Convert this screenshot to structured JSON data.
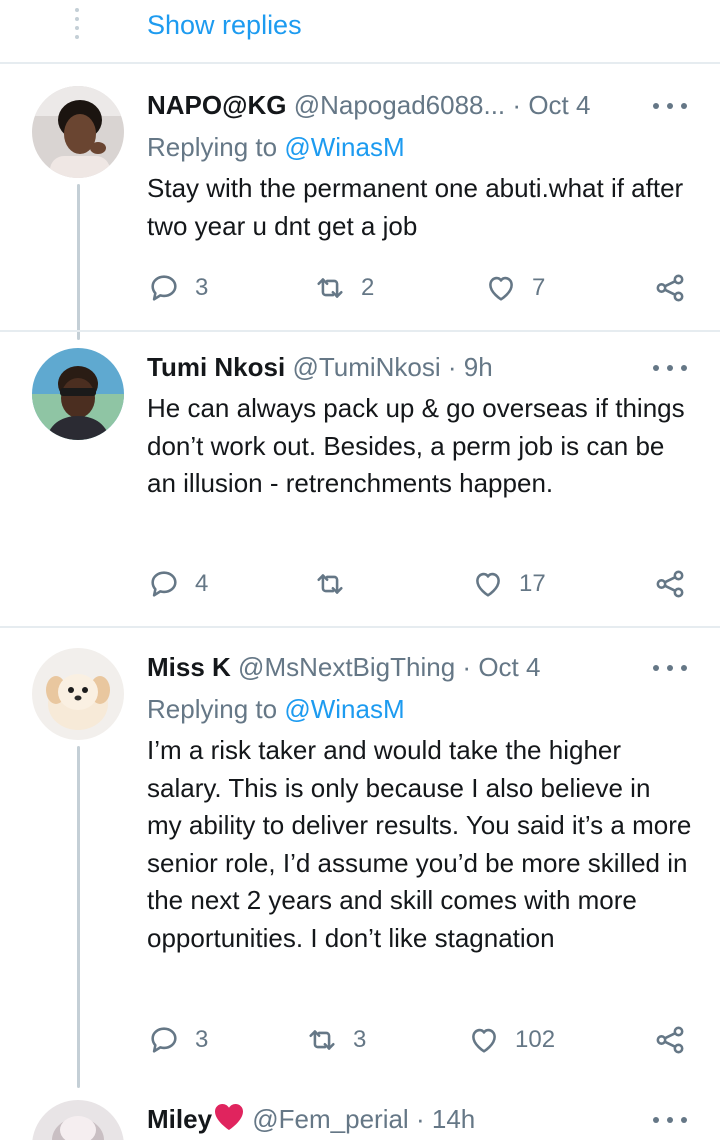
{
  "show_replies": "Show replies",
  "tweets": [
    {
      "name": "NAPO@KG",
      "handle": "@Napogad6088...",
      "time": "Oct 4",
      "replying_prefix": "Replying to",
      "replying_to": "@WinasM",
      "text": "Stay with the permanent one abuti.what if after two year u dnt get a job",
      "replies": "3",
      "retweets": "2",
      "likes": "7"
    },
    {
      "name": "Tumi Nkosi",
      "handle": "@TumiNkosi",
      "time": "9h",
      "text": "He can always pack up & go overseas if things don’t work out. Besides, a perm job is can be an illusion - retrenchments happen.",
      "replies": "4",
      "retweets": "",
      "likes": "17"
    },
    {
      "name": "Miss K",
      "handle": "@MsNextBigThing",
      "time": "Oct 4",
      "replying_prefix": "Replying to",
      "replying_to": "@WinasM",
      "text": "I’m a risk taker and would take the higher salary. This is only because I also believe in my ability to deliver results. You said it’s a more senior role, I’d assume you’d be more skilled in the next 2 years and skill comes with more opportunities. I don’t like stagnation",
      "replies": "3",
      "retweets": "3",
      "likes": "102"
    },
    {
      "name": "Miley",
      "handle": "@Fem_perial",
      "time": "14h"
    }
  ],
  "separator": "·",
  "colors": {
    "accent": "#1d9bf0",
    "secondary_text": "#657786",
    "divider": "#e6ecf0",
    "thread_line": "#c4cfd6",
    "heart_emoji": "#e0245e"
  }
}
